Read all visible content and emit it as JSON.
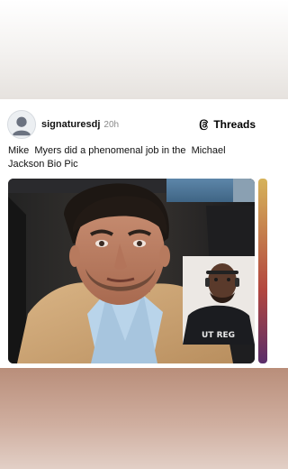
{
  "post": {
    "username": "signaturesdj",
    "time": "20h",
    "brand": "Threads",
    "text": "Mike  Myers did a phenomenal job in the  Michael Jackson Bio Pic"
  },
  "icons": {
    "avatar": "default-profile-icon",
    "brand": "threads-logo-icon"
  }
}
